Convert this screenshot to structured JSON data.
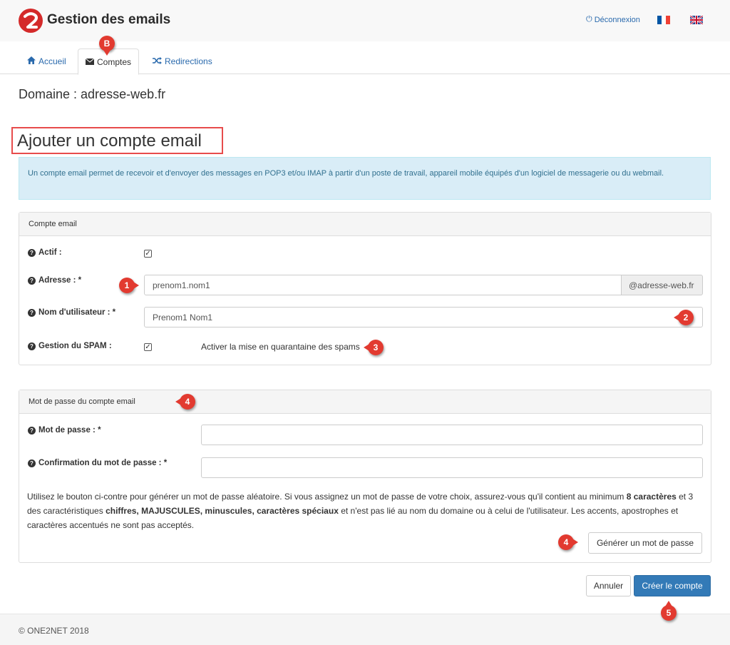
{
  "header": {
    "title": "Gestion des emails",
    "logout_label": "Déconnexion",
    "flags": [
      {
        "name": "fr",
        "colors": [
          "#0055a4",
          "#ffffff",
          "#ef4135"
        ]
      },
      {
        "name": "uk",
        "colors": [
          "#1f3f8f",
          "#ffffff",
          "#c8102e"
        ]
      }
    ]
  },
  "tabs": [
    {
      "label": "Accueil",
      "icon": "home-icon",
      "active": false
    },
    {
      "label": "Comptes",
      "icon": "envelope-icon",
      "active": true
    },
    {
      "label": "Redirections",
      "icon": "shuffle-icon",
      "active": false
    }
  ],
  "domain_line": "Domaine : adresse-web.fr",
  "page_title": "Ajouter un compte email",
  "info_text": "Un compte email permet de recevoir et d'envoyer des messages en POP3 et/ou IMAP à partir d'un poste de travail, appareil mobile équipés d'un logiciel de messagerie ou du webmail.",
  "account_panel": {
    "heading": "Compte email",
    "active_label": "Actif :",
    "active_checked": true,
    "address_label": "Adresse : *",
    "address_value": "prenom1.nom1",
    "address_suffix": "@adresse-web.fr",
    "username_label": "Nom d'utilisateur : *",
    "username_value": "Prenom1 Nom1",
    "spam_label": "Gestion du SPAM :",
    "spam_checked": true,
    "spam_text": "Activer la mise en quarantaine des spams"
  },
  "password_panel": {
    "heading": "Mot de passe du compte email",
    "password_label": "Mot de passe : *",
    "confirm_label": "Confirmation du mot de passe : *",
    "help": {
      "p1": "Utilisez le bouton ci-contre pour générer un mot de passe aléatoire. Si vous assignez un mot de passe de votre choix, assurez-vous qu'il contient au minimum ",
      "b1": "8 caractères",
      "p2": " et 3 des caractéristiques ",
      "b2": "chiffres, MAJUSCULES, minuscules, caractères spéciaux",
      "p3": " et n'est pas lié au nom du domaine ou à celui de l'utilisateur. Les accents, apostrophes et caractères accentués ne sont pas acceptés."
    },
    "generate_label": "Générer un mot de passe"
  },
  "actions": {
    "cancel_label": "Annuler",
    "create_label": "Créer le compte"
  },
  "footer": "© ONE2NET 2018",
  "markers": {
    "b": "B",
    "m1": "1",
    "m2": "2",
    "m3": "3",
    "m4a": "4",
    "m4b": "4",
    "m5": "5"
  },
  "colors": {
    "brand_red": "#d42a2a",
    "link_blue": "#2a6aad",
    "primary": "#337ab7",
    "info_bg": "#d9edf7",
    "marker_red": "#e23a30"
  }
}
